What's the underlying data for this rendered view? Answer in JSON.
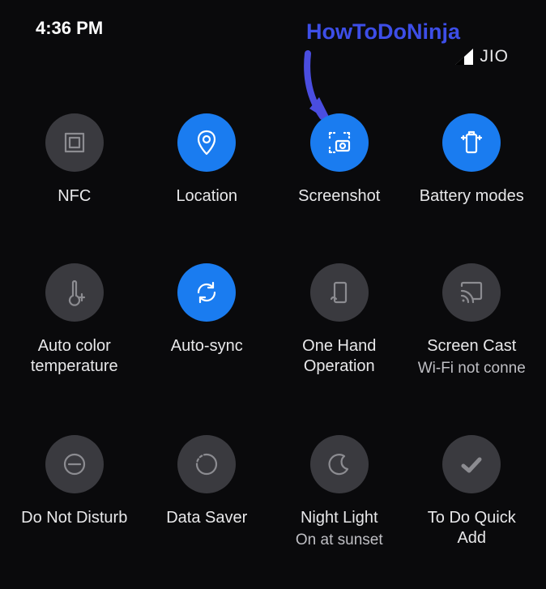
{
  "status": {
    "time": "4:36 PM",
    "carrier": "JIO"
  },
  "annotation": {
    "text": "HowToDoNinja"
  },
  "tiles": {
    "nfc": {
      "label": "NFC"
    },
    "location": {
      "label": "Location"
    },
    "screenshot": {
      "label": "Screenshot"
    },
    "battery": {
      "label": "Battery modes"
    },
    "autocolor": {
      "label": "Auto color\ntemperature"
    },
    "autosync": {
      "label": "Auto-sync"
    },
    "onehand": {
      "label": "One Hand\nOperation"
    },
    "cast": {
      "label": "Screen Cast",
      "sub": "Wi-Fi not conne"
    },
    "dnd": {
      "label": "Do Not Disturb"
    },
    "datasaver": {
      "label": "Data Saver"
    },
    "nightlight": {
      "label": "Night Light",
      "sub": "On at sunset"
    },
    "todo": {
      "label": "To Do Quick\nAdd"
    }
  }
}
